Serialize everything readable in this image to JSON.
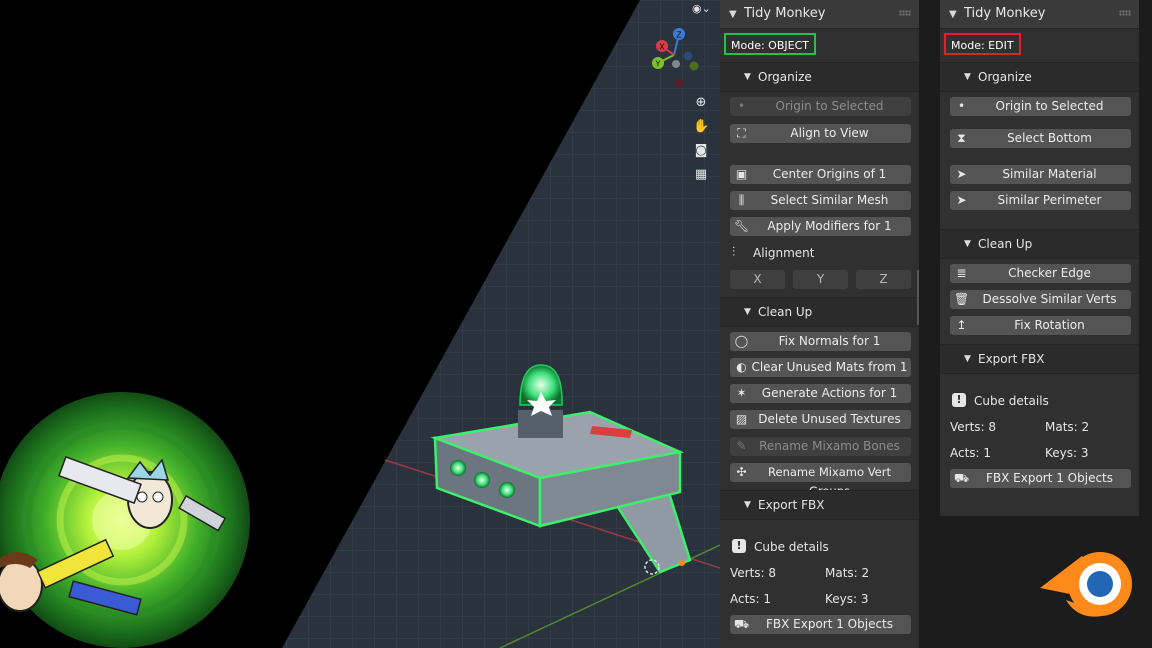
{
  "colors": {
    "object_mode_border": "#22c24a",
    "edit_mode_border": "#e0202a",
    "accent": "#ff8a1c"
  },
  "panel_object": {
    "title": "Tidy Monkey",
    "mode": "Mode: OBJECT",
    "organize": {
      "label": "Organize",
      "buttons": [
        {
          "label": "Origin to Selected",
          "icon": "dot-icon",
          "enabled": false
        },
        {
          "label": "Align to View",
          "icon": "align-view-icon",
          "enabled": true
        },
        {
          "label": "Center Origins of 1",
          "icon": "origin-square-icon",
          "enabled": true
        },
        {
          "label": "Select Similar Mesh",
          "icon": "comb-icon",
          "enabled": true
        },
        {
          "label": "Apply Modifiers for 1",
          "icon": "wrench-icon",
          "enabled": true
        }
      ],
      "alignment_label": "Alignment",
      "axes": [
        "X",
        "Y",
        "Z"
      ]
    },
    "cleanup": {
      "label": "Clean Up",
      "buttons": [
        {
          "label": "Fix Normals for 1",
          "icon": "normals-circle-icon",
          "enabled": true
        },
        {
          "label": "Clear Unused Mats from 1",
          "icon": "material-sphere-icon",
          "enabled": true
        },
        {
          "label": "Generate Actions for 1",
          "icon": "running-man-icon",
          "enabled": true
        },
        {
          "label": "Delete Unused Textures",
          "icon": "image-icon",
          "enabled": true
        },
        {
          "label": "Rename Mixamo Bones",
          "icon": "bone-icon",
          "enabled": false
        },
        {
          "label": "Rename Mixamo Vert Groups",
          "icon": "vertex-group-icon",
          "enabled": true
        }
      ]
    },
    "export": {
      "label": "Export FBX",
      "details_title": "Cube details",
      "verts": "Verts: 8",
      "mats": "Mats: 2",
      "acts": "Acts: 1",
      "keys": "Keys: 3",
      "export_button": "FBX Export 1 Objects"
    }
  },
  "panel_edit": {
    "title": "Tidy Monkey",
    "mode": "Mode: EDIT",
    "organize": {
      "label": "Organize",
      "buttons": [
        {
          "label": "Origin to Selected",
          "icon": "dot-icon"
        },
        {
          "label": "Select Bottom",
          "icon": "select-bottom-icon"
        },
        {
          "label": "Similar Material",
          "icon": "cursor-arrow-icon"
        },
        {
          "label": "Similar Perimeter",
          "icon": "cursor-arrow-icon"
        }
      ]
    },
    "cleanup": {
      "label": "Clean Up",
      "buttons": [
        {
          "label": "Checker Edge",
          "icon": "lines-icon"
        },
        {
          "label": "Dessolve Similar Verts",
          "icon": "trash-icon"
        },
        {
          "label": "Fix Rotation",
          "icon": "rotate-arrow-icon"
        }
      ]
    },
    "export": {
      "label": "Export FBX",
      "details_title": "Cube details",
      "verts": "Verts: 8",
      "mats": "Mats: 2",
      "acts": "Acts: 1",
      "keys": "Keys: 3",
      "export_button": "FBX Export 1 Objects"
    }
  },
  "viewport": {
    "gizmo_axes": [
      "Z",
      "Y",
      "X"
    ],
    "nav_icons": [
      "zoom-icon",
      "pan-hand-icon",
      "camera-icon",
      "grid-perspective-icon"
    ]
  }
}
